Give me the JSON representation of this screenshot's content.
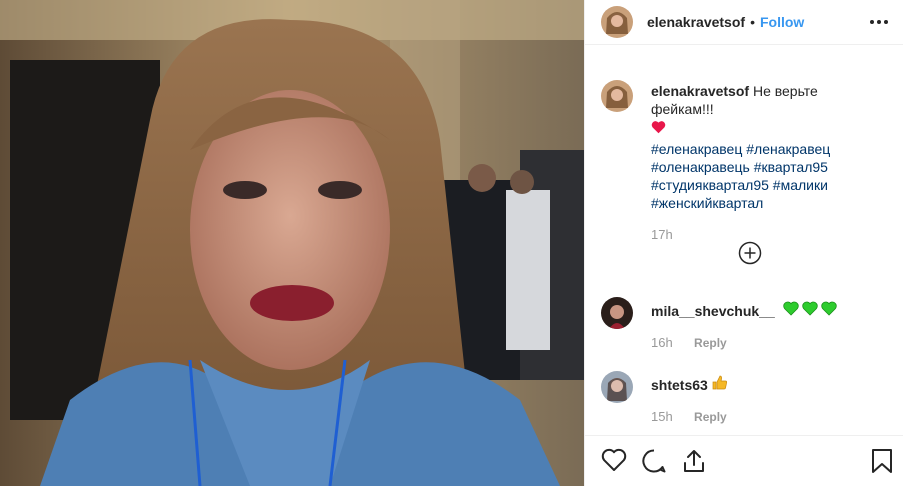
{
  "post": {
    "author": "elenakravetsof",
    "follow_label": "Follow",
    "separator": "•",
    "caption": {
      "author": "elenakravetsof",
      "text": "Не верьте фейкам!!!",
      "emoji": "heart",
      "hashtags": [
        "#еленакравец #ленакравец",
        "#оленакравець #квартал95",
        "#студияквартал95 #малики",
        "#женскийквартал"
      ],
      "time": "17h"
    }
  },
  "comments": [
    {
      "username": "mila__shevchuk__",
      "emoji": "green-hearts",
      "time": "16h",
      "reply_label": "Reply"
    },
    {
      "username": "shtets63",
      "emoji": "thumbs-up",
      "time": "15h",
      "reply_label": "Reply"
    }
  ],
  "icons": {
    "more": "more-horizontal-icon",
    "load_more": "plus-circle-icon",
    "like": "heart-outline-icon",
    "comment": "comment-icon",
    "share": "share-icon",
    "save": "bookmark-icon"
  },
  "colors": {
    "follow": "#3897f0",
    "hashtag": "#003569",
    "meta": "#999999",
    "heart": "#e8174a",
    "green_heart": "#2ecc2e"
  }
}
